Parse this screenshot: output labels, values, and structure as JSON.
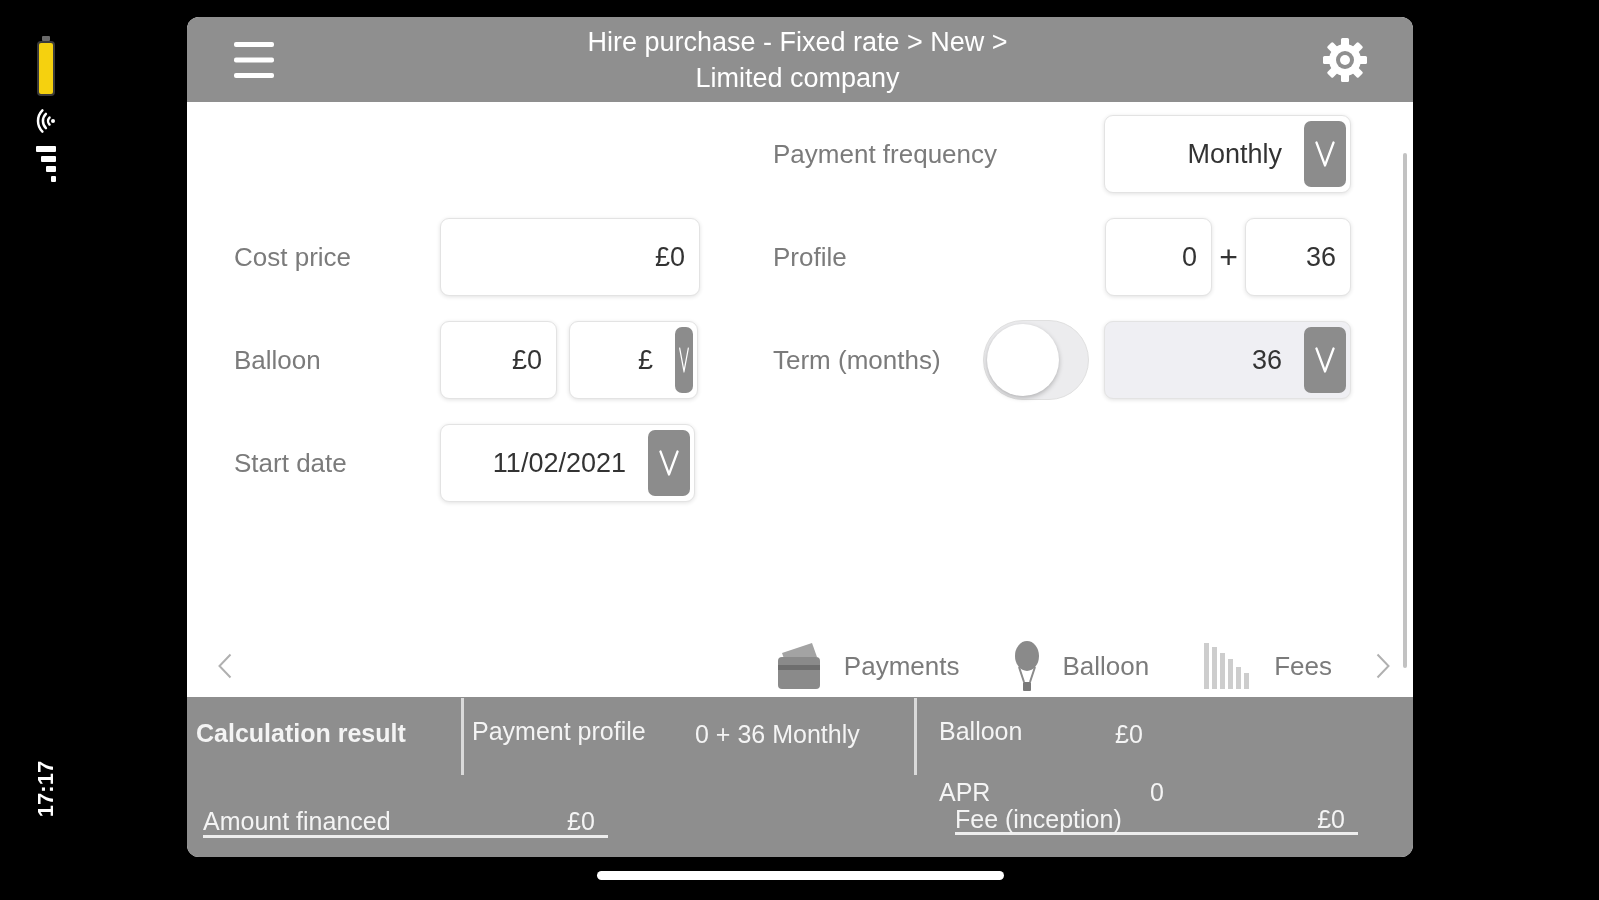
{
  "status_bar": {
    "time": "17:17"
  },
  "header": {
    "title": "Hire purchase - Fixed rate > New > Limited company"
  },
  "form": {
    "right": [
      {
        "kind": "dropdown",
        "label": "Payment frequency",
        "value": "Monthly",
        "disabled": false
      },
      {
        "kind": "pair",
        "label": "Profile",
        "values": [
          "0",
          "36"
        ],
        "joiner": "+"
      },
      {
        "kind": "toggle_dropdown",
        "label": "Term (months)",
        "on": false,
        "value": "36",
        "disabled": true
      }
    ],
    "left": [
      {
        "kind": "input",
        "label": "Cost price",
        "value": "£0"
      },
      {
        "kind": "amount_unit",
        "label": "Balloon",
        "value": "£0",
        "unit": "£"
      },
      {
        "kind": "dropdown",
        "label": "Start date",
        "value": "11/02/2021",
        "disabled": false
      }
    ]
  },
  "nav": {
    "items": [
      {
        "label": "Payments",
        "selected": false
      },
      {
        "label": "Balloon",
        "selected": false
      },
      {
        "label": "Fees",
        "selected": false
      }
    ]
  },
  "results": {
    "title": "Calculation result",
    "payment_profile": {
      "label": "Payment profile",
      "value": "0 + 36 Monthly"
    },
    "balloon": {
      "label": "Balloon",
      "value": "£0"
    },
    "amount_financed": {
      "label": "Amount financed",
      "value": "£0"
    },
    "apr": {
      "label": "APR",
      "value": "0"
    },
    "fee_inception": {
      "label": "Fee (inception)",
      "value": "£0"
    }
  }
}
